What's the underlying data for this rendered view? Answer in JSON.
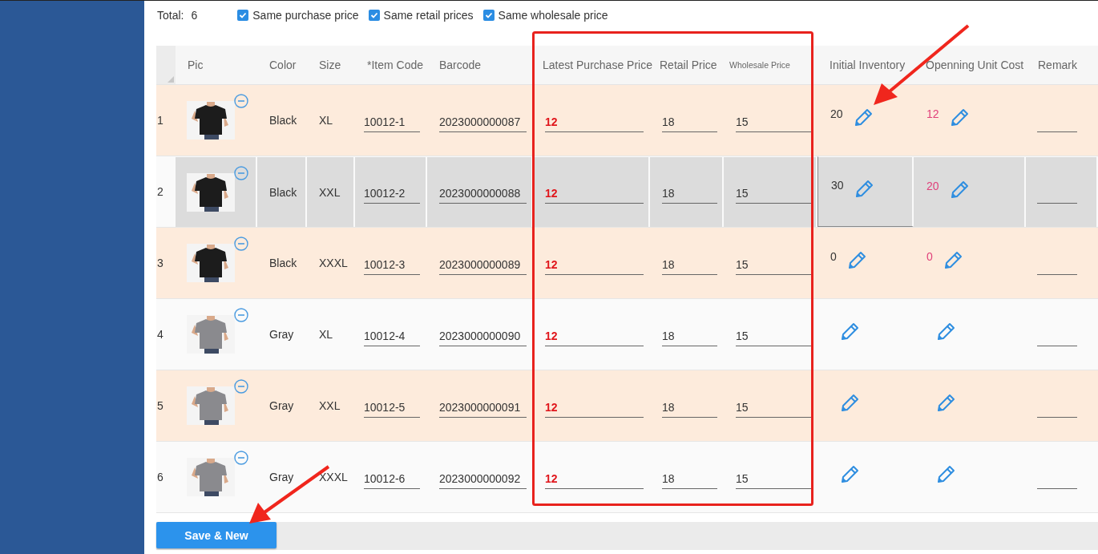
{
  "toolbar": {
    "total_label": "Total:",
    "total_value": "6",
    "options": [
      {
        "label": "Same purchase price",
        "checked": true
      },
      {
        "label": "Same retail prices",
        "checked": true
      },
      {
        "label": "Same wholesale price",
        "checked": true
      }
    ]
  },
  "table": {
    "columns": [
      "Pic",
      "Color",
      "Size",
      "*Item Code",
      "Barcode",
      "Latest Purchase Price",
      "Retail Price",
      "Wholesale Price",
      "Initial Inventory",
      "Openning Unit Cost",
      "Remark"
    ],
    "rows": [
      {
        "index": "1",
        "color_name": "Black",
        "size": "XL",
        "item_code": "10012-1",
        "barcode": "2023000000087",
        "latest_purchase_price": "12",
        "retail_price": "18",
        "wholesale_price": "15",
        "initial_inventory": "20",
        "opening_unit_cost": "12",
        "selected": false
      },
      {
        "index": "2",
        "color_name": "Black",
        "size": "XXL",
        "item_code": "10012-2",
        "barcode": "2023000000088",
        "latest_purchase_price": "12",
        "retail_price": "18",
        "wholesale_price": "15",
        "initial_inventory": "30",
        "opening_unit_cost": "20",
        "selected": true
      },
      {
        "index": "3",
        "color_name": "Black",
        "size": "XXXL",
        "item_code": "10012-3",
        "barcode": "2023000000089",
        "latest_purchase_price": "12",
        "retail_price": "18",
        "wholesale_price": "15",
        "initial_inventory": "0",
        "opening_unit_cost": "0",
        "selected": false
      },
      {
        "index": "4",
        "color_name": "Gray",
        "size": "XL",
        "item_code": "10012-4",
        "barcode": "2023000000090",
        "latest_purchase_price": "12",
        "retail_price": "18",
        "wholesale_price": "15",
        "selected": false
      },
      {
        "index": "5",
        "color_name": "Gray",
        "size": "XXL",
        "item_code": "10012-5",
        "barcode": "2023000000091",
        "latest_purchase_price": "12",
        "retail_price": "18",
        "wholesale_price": "15",
        "selected": false
      },
      {
        "index": "6",
        "color_name": "Gray",
        "size": "XXXL",
        "item_code": "10012-6",
        "barcode": "2023000000092",
        "latest_purchase_price": "12",
        "retail_price": "18",
        "wholesale_price": "15",
        "selected": false
      }
    ]
  },
  "footer": {
    "button": "Save & New"
  }
}
